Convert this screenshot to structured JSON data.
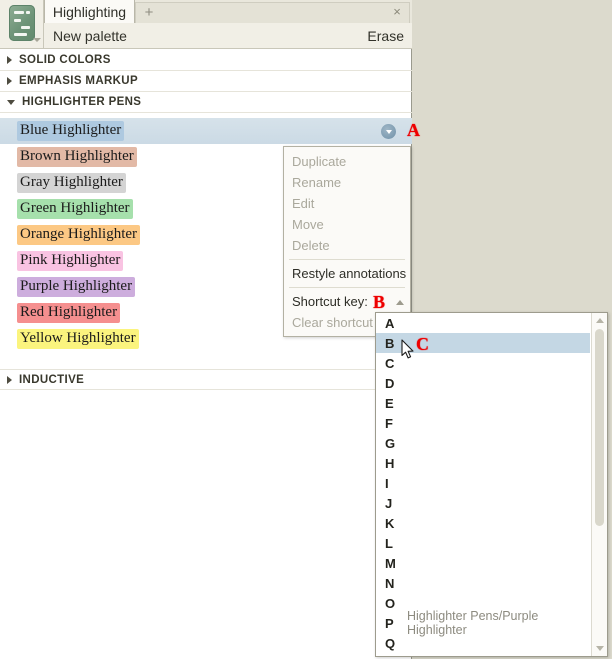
{
  "window": {
    "tab_label": "Highlighting",
    "new_tab_icon": "+",
    "close_icon": "×",
    "app_icon": "palette-document-icon"
  },
  "toolbar": {
    "new_palette_label": "New palette",
    "erase_label": "Erase"
  },
  "sections": [
    {
      "label": "SOLID COLORS",
      "expanded": false
    },
    {
      "label": "EMPHASIS MARKUP",
      "expanded": false
    },
    {
      "label": "HIGHLIGHTER PENS",
      "expanded": true
    },
    {
      "label": "INDUCTIVE",
      "expanded": false
    }
  ],
  "pens": [
    {
      "label": "Blue Highlighter",
      "color": "#aec9e0",
      "selected": true
    },
    {
      "label": "Brown Highlighter",
      "color": "#e2b9a6",
      "selected": false
    },
    {
      "label": "Gray Highlighter",
      "color": "#d4d4d4",
      "selected": false
    },
    {
      "label": "Green Highlighter",
      "color": "#a6e0ac",
      "selected": false
    },
    {
      "label": "Orange Highlighter",
      "color": "#fcc884",
      "selected": false
    },
    {
      "label": "Pink Highlighter",
      "color": "#f9c3e2",
      "selected": false
    },
    {
      "label": "Purple Highlighter",
      "color": "#cdaddd",
      "selected": false
    },
    {
      "label": "Red Highlighter",
      "color": "#f58f8f",
      "selected": false
    },
    {
      "label": "Yellow Highlighter",
      "color": "#fbf47e",
      "selected": false
    }
  ],
  "context_menu": {
    "items": [
      {
        "label": "Duplicate",
        "enabled": false
      },
      {
        "label": "Rename",
        "enabled": false
      },
      {
        "label": "Edit",
        "enabled": false
      },
      {
        "label": "Move",
        "enabled": false
      },
      {
        "label": "Delete",
        "enabled": false
      }
    ],
    "restyle_label": "Restyle annotations",
    "shortcut_label": "Shortcut key:",
    "clear_label": "Clear shortcut"
  },
  "key_dropdown": {
    "rows": [
      {
        "letter": "A",
        "assignment": "",
        "selected": false
      },
      {
        "letter": "B",
        "assignment": "",
        "selected": true
      },
      {
        "letter": "C",
        "assignment": "",
        "selected": false
      },
      {
        "letter": "D",
        "assignment": "",
        "selected": false
      },
      {
        "letter": "E",
        "assignment": "",
        "selected": false
      },
      {
        "letter": "F",
        "assignment": "",
        "selected": false
      },
      {
        "letter": "G",
        "assignment": "",
        "selected": false
      },
      {
        "letter": "H",
        "assignment": "",
        "selected": false
      },
      {
        "letter": "I",
        "assignment": "",
        "selected": false
      },
      {
        "letter": "J",
        "assignment": "",
        "selected": false
      },
      {
        "letter": "K",
        "assignment": "",
        "selected": false
      },
      {
        "letter": "L",
        "assignment": "",
        "selected": false
      },
      {
        "letter": "M",
        "assignment": "",
        "selected": false
      },
      {
        "letter": "N",
        "assignment": "",
        "selected": false
      },
      {
        "letter": "O",
        "assignment": "",
        "selected": false
      },
      {
        "letter": "P",
        "assignment": "Highlighter Pens/Purple Highlighter",
        "selected": false
      },
      {
        "letter": "Q",
        "assignment": "",
        "selected": false
      }
    ]
  },
  "annotations": [
    {
      "id": "anno-a",
      "label": "A"
    },
    {
      "id": "anno-b",
      "label": "B"
    },
    {
      "id": "anno-c",
      "label": "C"
    }
  ],
  "colors": {
    "panel_background": "#ffffff",
    "desktop_background": "#dcdacd",
    "selection_blue": "#c4d7e4",
    "annotation_red": "#ee0000"
  }
}
